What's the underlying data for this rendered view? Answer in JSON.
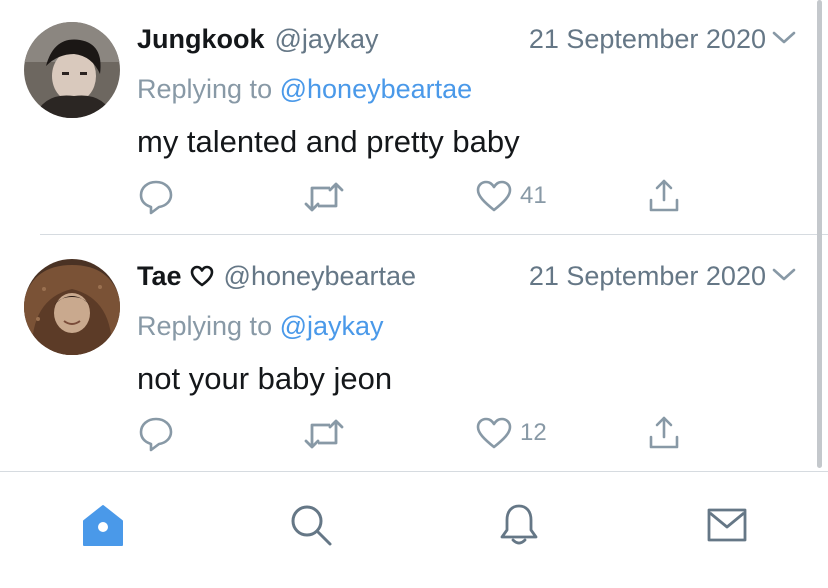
{
  "colors": {
    "accent": "#4a99e9",
    "text_primary": "#14171a",
    "text_secondary": "#657786",
    "icon_gray": "#8899a6",
    "divider": "#d6dbe0"
  },
  "tweets": [
    {
      "display_name": "Jungkook",
      "handle": "@jaykay",
      "date": "21 September 2020",
      "replying_prefix": "Replying to",
      "replying_to": "@honeybeartae",
      "text": "my talented and pretty baby",
      "like_count": "41",
      "has_heart_in_name": false
    },
    {
      "display_name": "Tae",
      "handle": "@honeybeartae",
      "date": "21 September 2020",
      "replying_prefix": "Replying to",
      "replying_to": "@jaykay",
      "text": "not your baby jeon",
      "like_count": "12",
      "has_heart_in_name": true
    }
  ],
  "actions": [
    "reply-icon",
    "retweet-icon",
    "like-icon",
    "share-icon"
  ],
  "tabbar": {
    "tabs": [
      {
        "name": "home",
        "icon": "home-icon",
        "active": true
      },
      {
        "name": "search",
        "icon": "search-icon",
        "active": false
      },
      {
        "name": "notifications",
        "icon": "bell-icon",
        "active": false
      },
      {
        "name": "messages",
        "icon": "mail-icon",
        "active": false
      }
    ]
  }
}
